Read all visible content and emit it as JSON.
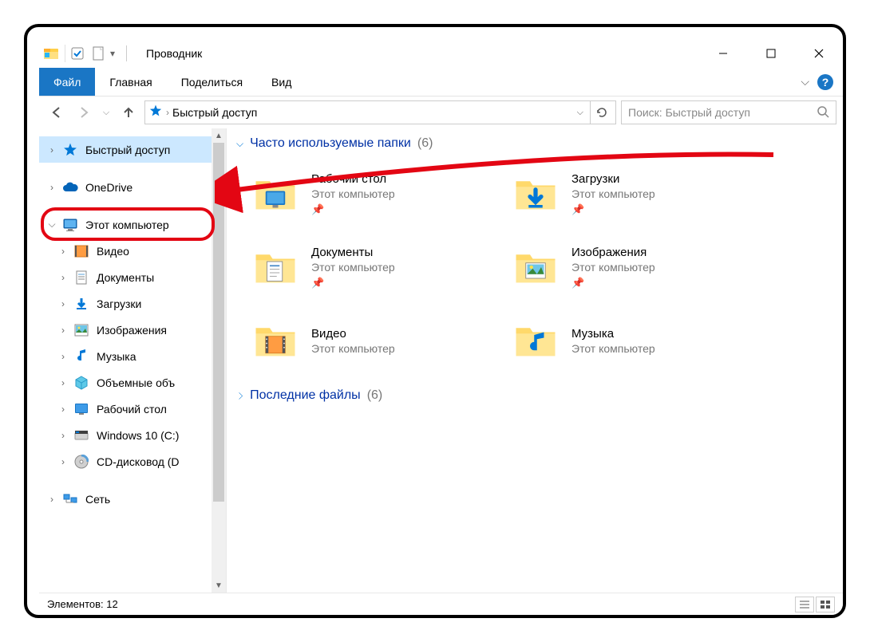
{
  "title": "Проводник",
  "ribbon": {
    "file": "Файл",
    "home": "Главная",
    "share": "Поделиться",
    "view": "Вид"
  },
  "address": {
    "location": "Быстрый доступ"
  },
  "search": {
    "placeholder": "Поиск: Быстрый доступ"
  },
  "sidebar": {
    "quick": "Быстрый доступ",
    "onedrive": "OneDrive",
    "thispc": "Этот компьютер",
    "children": [
      "Видео",
      "Документы",
      "Загрузки",
      "Изображения",
      "Музыка",
      "Объемные объ",
      "Рабочий стол",
      "Windows 10 (C:)",
      "CD-дисковод (D"
    ],
    "network": "Сеть"
  },
  "groups": {
    "frequent": {
      "label": "Часто используемые папки",
      "count": "(6)"
    },
    "recent": {
      "label": "Последние файлы",
      "count": "(6)"
    }
  },
  "folders": [
    {
      "name": "Рабочий стол",
      "sub": "Этот компьютер"
    },
    {
      "name": "Загрузки",
      "sub": "Этот компьютер"
    },
    {
      "name": "Документы",
      "sub": "Этот компьютер"
    },
    {
      "name": "Изображения",
      "sub": "Этот компьютер"
    },
    {
      "name": "Видео",
      "sub": "Этот компьютер"
    },
    {
      "name": "Музыка",
      "sub": "Этот компьютер"
    }
  ],
  "status": {
    "count": "Элементов: 12"
  }
}
